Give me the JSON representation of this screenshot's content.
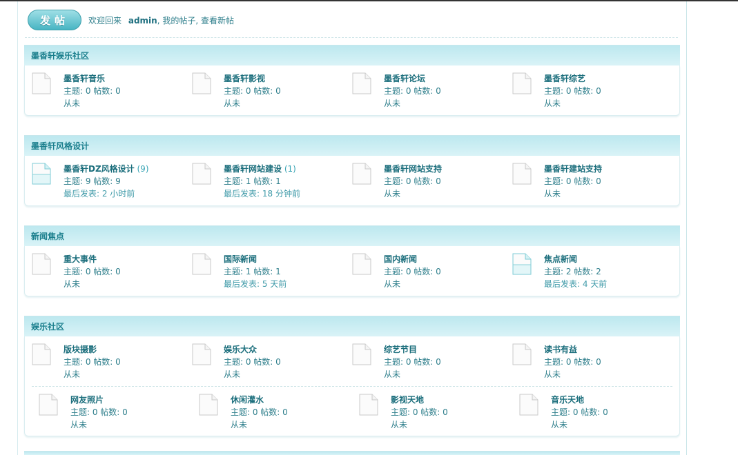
{
  "toolbar": {
    "post_label": "发帖",
    "welcome_prefix": "欢迎回来",
    "username": "admin",
    "my_posts": "我的帖子",
    "new_posts": "查看新帖"
  },
  "categories": [
    {
      "title": "墨香轩娱乐社区",
      "rows": [
        [
          {
            "name": "墨香轩音乐",
            "count": "",
            "stats": "主题: 0 帖数: 0",
            "last": "从未",
            "new": false
          },
          {
            "name": "墨香轩影视",
            "count": "",
            "stats": "主题: 0 帖数: 0",
            "last": "从未",
            "new": false
          },
          {
            "name": "墨香轩论坛",
            "count": "",
            "stats": "主题: 0 帖数: 0",
            "last": "从未",
            "new": false
          },
          {
            "name": "墨香轩综艺",
            "count": "",
            "stats": "主题: 0 帖数: 0",
            "last": "从未",
            "new": false
          }
        ]
      ]
    },
    {
      "title": "墨香轩风格设计",
      "rows": [
        [
          {
            "name": "墨香轩DZ风格设计",
            "count": "(9)",
            "stats": "主题: 9 帖数: 9",
            "last": "最后发表: 2 小时前",
            "new": true
          },
          {
            "name": "墨香轩网站建设",
            "count": "(1)",
            "stats": "主题: 1 帖数: 1",
            "last": "最后发表: 18 分钟前",
            "new": false
          },
          {
            "name": "墨香轩网站支持",
            "count": "",
            "stats": "主题: 0 帖数: 0",
            "last": "从未",
            "new": false
          },
          {
            "name": "墨香轩建站支持",
            "count": "",
            "stats": "主题: 0 帖数: 0",
            "last": "从未",
            "new": false
          }
        ]
      ]
    },
    {
      "title": "新闻焦点",
      "rows": [
        [
          {
            "name": "重大事件",
            "count": "",
            "stats": "主题: 0 帖数: 0",
            "last": "从未",
            "new": false
          },
          {
            "name": "国际新闻",
            "count": "",
            "stats": "主题: 1 帖数: 1",
            "last": "最后发表: 5 天前",
            "new": false
          },
          {
            "name": "国内新闻",
            "count": "",
            "stats": "主题: 0 帖数: 0",
            "last": "从未",
            "new": false
          },
          {
            "name": "焦点新闻",
            "count": "",
            "stats": "主题: 2 帖数: 2",
            "last": "最后发表: 4 天前",
            "new": true
          }
        ]
      ]
    },
    {
      "title": "娱乐社区",
      "rows": [
        [
          {
            "name": "版块摄影",
            "count": "",
            "stats": "主题: 0 帖数: 0",
            "last": "从未",
            "new": false
          },
          {
            "name": "娱乐大众",
            "count": "",
            "stats": "主题: 0 帖数: 0",
            "last": "从未",
            "new": false
          },
          {
            "name": "综艺节目",
            "count": "",
            "stats": "主题: 0 帖数: 0",
            "last": "从未",
            "new": false
          },
          {
            "name": "读书有益",
            "count": "",
            "stats": "主题: 0 帖数: 0",
            "last": "从未",
            "new": false
          }
        ],
        [
          {
            "name": "网友照片",
            "count": "",
            "stats": "主题: 0 帖数: 0",
            "last": "从未",
            "new": false
          },
          {
            "name": "休闲灌水",
            "count": "",
            "stats": "主题: 0 帖数: 0",
            "last": "从未",
            "new": false
          },
          {
            "name": "影视天地",
            "count": "",
            "stats": "主题: 0 帖数: 0",
            "last": "从未",
            "new": false
          },
          {
            "name": "音乐天地",
            "count": "",
            "stats": "主题: 0 帖数: 0",
            "last": "从未",
            "new": false
          }
        ]
      ]
    }
  ]
}
